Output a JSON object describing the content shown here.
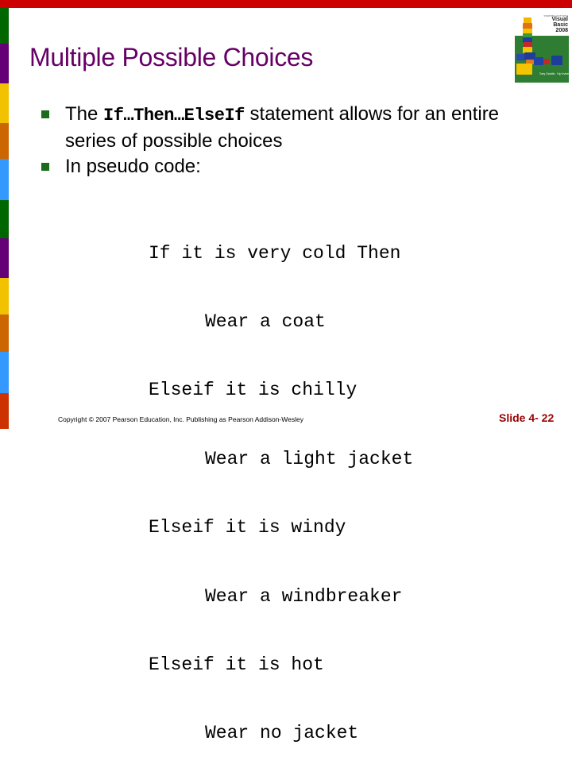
{
  "slide": {
    "title": "Multiple Possible Choices",
    "bullets": [
      {
        "text_before": "The ",
        "code": "If…Then…ElseIf",
        "text_after": " statement allows for an entire series of possible choices"
      },
      {
        "text_before": "In pseudo code:",
        "code": "",
        "text_after": ""
      }
    ],
    "pseudo_code": [
      {
        "text": "If it is very cold Then",
        "indent": false
      },
      {
        "text": "Wear a coat",
        "indent": true
      },
      {
        "text": "Elseif it is chilly",
        "indent": false
      },
      {
        "text": "Wear a light jacket",
        "indent": true
      },
      {
        "text": "Elseif it is windy",
        "indent": false
      },
      {
        "text": "Wear a windbreaker",
        "indent": true
      },
      {
        "text": "Elseif it is hot",
        "indent": false
      },
      {
        "text": "Wear no jacket",
        "indent": true
      }
    ],
    "footer": {
      "copyright": "Copyright © 2007 Pearson Education, Inc. Publishing as Pearson Addison-Wesley",
      "slide_number": "Slide 4- 22"
    }
  },
  "book_cover": {
    "kicker": "STARTING OUT WITH",
    "title_line1": "Visual Basic",
    "title_line2": "2008",
    "authors": "Tony Gaddis · Kip Irvine"
  },
  "theme": {
    "title_color": "#660066",
    "bullet_color": "#1a6b1a",
    "top_bar_color": "#cc0000",
    "slide_number_color": "#990000",
    "side_strip_colors": [
      "#006600",
      "#660077",
      "#f2c200",
      "#cc6600",
      "#3399ff",
      "#006600",
      "#660077",
      "#f2c200",
      "#cc6600",
      "#3399ff",
      "#cc3300"
    ]
  }
}
